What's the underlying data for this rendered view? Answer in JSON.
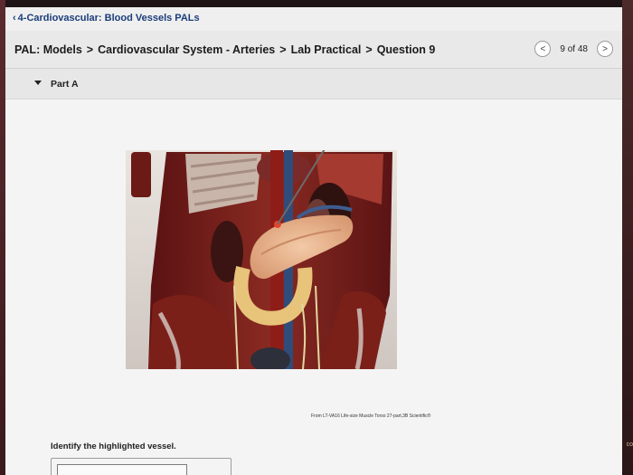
{
  "header": {
    "back_link": "4-Cardiovascular: Blood Vessels PALs",
    "back_icon": "chevron-left-icon"
  },
  "breadcrumb": {
    "items": [
      "PAL: Models",
      "Cardiovascular System - Arteries",
      "Lab Practical",
      "Question 9"
    ],
    "separator": ">"
  },
  "pager": {
    "prev_symbol": "<",
    "next_symbol": ">",
    "count": "9 of 48"
  },
  "part": {
    "label": "Part A"
  },
  "figure": {
    "alt": "model-of-abdominal-viscera-and-arteries",
    "credit": "From LT-VA16 Life-size Muscle Torso 27-part,3B Scientific®"
  },
  "question": {
    "prompt": "Identify the highlighted vessel.",
    "answer_value": ""
  },
  "colors": {
    "link": "#1a3d7a",
    "highlight": "#e2452c",
    "bezel": "#3a1f22"
  },
  "edge_label": "co"
}
